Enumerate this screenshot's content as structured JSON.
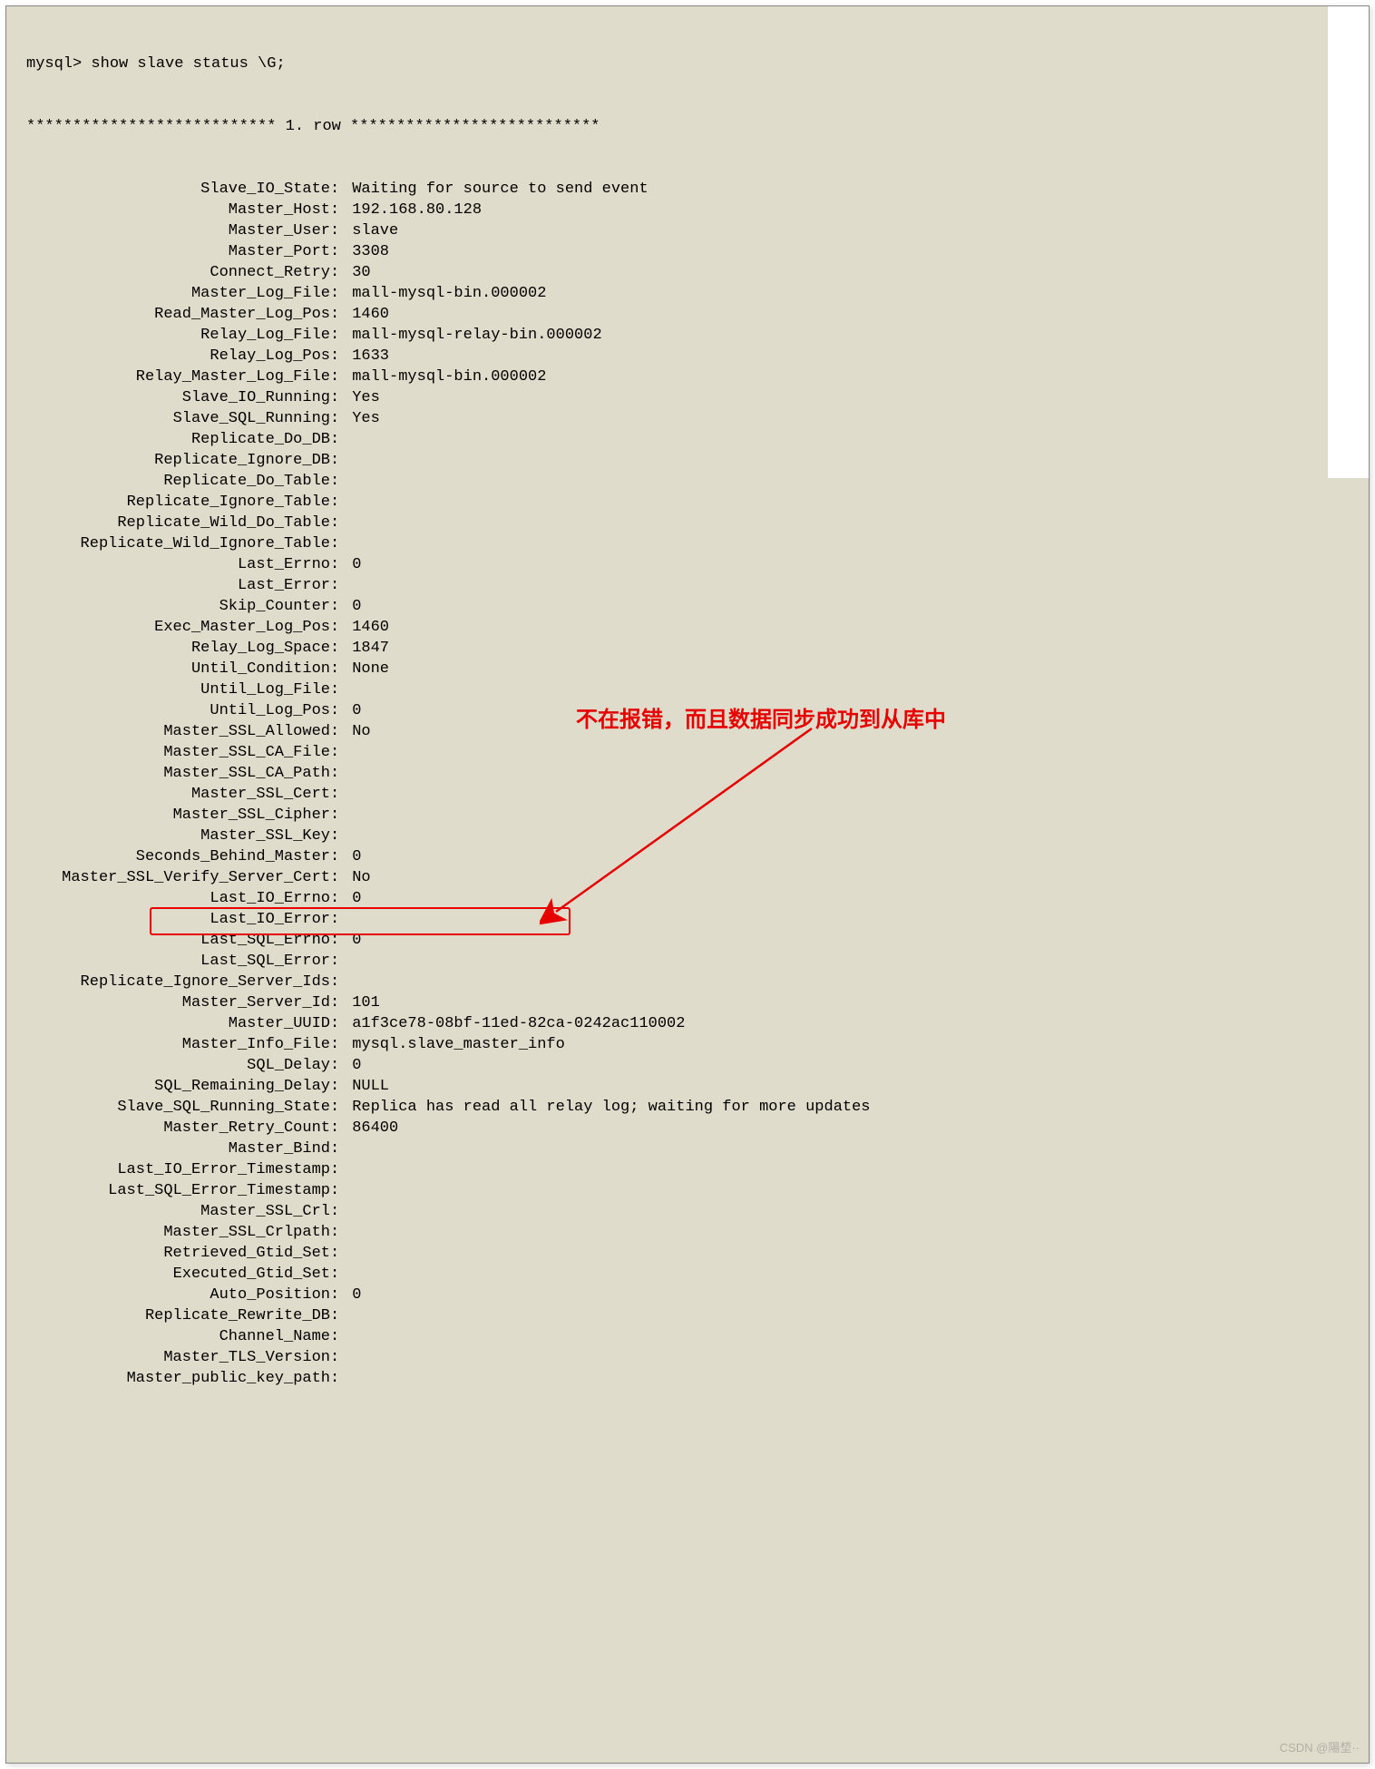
{
  "prompt_line": "mysql> show slave status \\G;",
  "row_header": "*************************** 1. row ***************************",
  "fields": [
    {
      "label": "Slave_IO_State",
      "value": "Waiting for source to send event"
    },
    {
      "label": "Master_Host",
      "value": "192.168.80.128"
    },
    {
      "label": "Master_User",
      "value": "slave"
    },
    {
      "label": "Master_Port",
      "value": "3308"
    },
    {
      "label": "Connect_Retry",
      "value": "30"
    },
    {
      "label": "Master_Log_File",
      "value": "mall-mysql-bin.000002"
    },
    {
      "label": "Read_Master_Log_Pos",
      "value": "1460"
    },
    {
      "label": "Relay_Log_File",
      "value": "mall-mysql-relay-bin.000002"
    },
    {
      "label": "Relay_Log_Pos",
      "value": "1633"
    },
    {
      "label": "Relay_Master_Log_File",
      "value": "mall-mysql-bin.000002"
    },
    {
      "label": "Slave_IO_Running",
      "value": "Yes"
    },
    {
      "label": "Slave_SQL_Running",
      "value": "Yes"
    },
    {
      "label": "Replicate_Do_DB",
      "value": ""
    },
    {
      "label": "Replicate_Ignore_DB",
      "value": ""
    },
    {
      "label": "Replicate_Do_Table",
      "value": ""
    },
    {
      "label": "Replicate_Ignore_Table",
      "value": ""
    },
    {
      "label": "Replicate_Wild_Do_Table",
      "value": ""
    },
    {
      "label": "Replicate_Wild_Ignore_Table",
      "value": ""
    },
    {
      "label": "Last_Errno",
      "value": "0"
    },
    {
      "label": "Last_Error",
      "value": ""
    },
    {
      "label": "Skip_Counter",
      "value": "0"
    },
    {
      "label": "Exec_Master_Log_Pos",
      "value": "1460"
    },
    {
      "label": "Relay_Log_Space",
      "value": "1847"
    },
    {
      "label": "Until_Condition",
      "value": "None"
    },
    {
      "label": "Until_Log_File",
      "value": ""
    },
    {
      "label": "Until_Log_Pos",
      "value": "0"
    },
    {
      "label": "Master_SSL_Allowed",
      "value": "No"
    },
    {
      "label": "Master_SSL_CA_File",
      "value": ""
    },
    {
      "label": "Master_SSL_CA_Path",
      "value": ""
    },
    {
      "label": "Master_SSL_Cert",
      "value": ""
    },
    {
      "label": "Master_SSL_Cipher",
      "value": ""
    },
    {
      "label": "Master_SSL_Key",
      "value": ""
    },
    {
      "label": "Seconds_Behind_Master",
      "value": "0"
    },
    {
      "label": "Master_SSL_Verify_Server_Cert",
      "value": "No"
    },
    {
      "label": "Last_IO_Errno",
      "value": "0"
    },
    {
      "label": "Last_IO_Error",
      "value": ""
    },
    {
      "label": "Last_SQL_Errno",
      "value": "0"
    },
    {
      "label": "Last_SQL_Error",
      "value": ""
    },
    {
      "label": "Replicate_Ignore_Server_Ids",
      "value": ""
    },
    {
      "label": "Master_Server_Id",
      "value": "101"
    },
    {
      "label": "Master_UUID",
      "value": "a1f3ce78-08bf-11ed-82ca-0242ac110002"
    },
    {
      "label": "Master_Info_File",
      "value": "mysql.slave_master_info"
    },
    {
      "label": "SQL_Delay",
      "value": "0"
    },
    {
      "label": "SQL_Remaining_Delay",
      "value": "NULL"
    },
    {
      "label": "Slave_SQL_Running_State",
      "value": "Replica has read all relay log; waiting for more updates"
    },
    {
      "label": "Master_Retry_Count",
      "value": "86400"
    },
    {
      "label": "Master_Bind",
      "value": ""
    },
    {
      "label": "Last_IO_Error_Timestamp",
      "value": ""
    },
    {
      "label": "Last_SQL_Error_Timestamp",
      "value": ""
    },
    {
      "label": "Master_SSL_Crl",
      "value": ""
    },
    {
      "label": "Master_SSL_Crlpath",
      "value": ""
    },
    {
      "label": "Retrieved_Gtid_Set",
      "value": ""
    },
    {
      "label": "Executed_Gtid_Set",
      "value": ""
    },
    {
      "label": "Auto_Position",
      "value": "0"
    },
    {
      "label": "Replicate_Rewrite_DB",
      "value": ""
    },
    {
      "label": "Channel_Name",
      "value": ""
    },
    {
      "label": "Master_TLS_Version",
      "value": ""
    },
    {
      "label": "Master_public_key_path",
      "value": ""
    }
  ],
  "annotation_text": "不在报错，而且数据同步成功到从库中",
  "highlight_row_index": 35,
  "watermark": "CSDN @陽堏··"
}
